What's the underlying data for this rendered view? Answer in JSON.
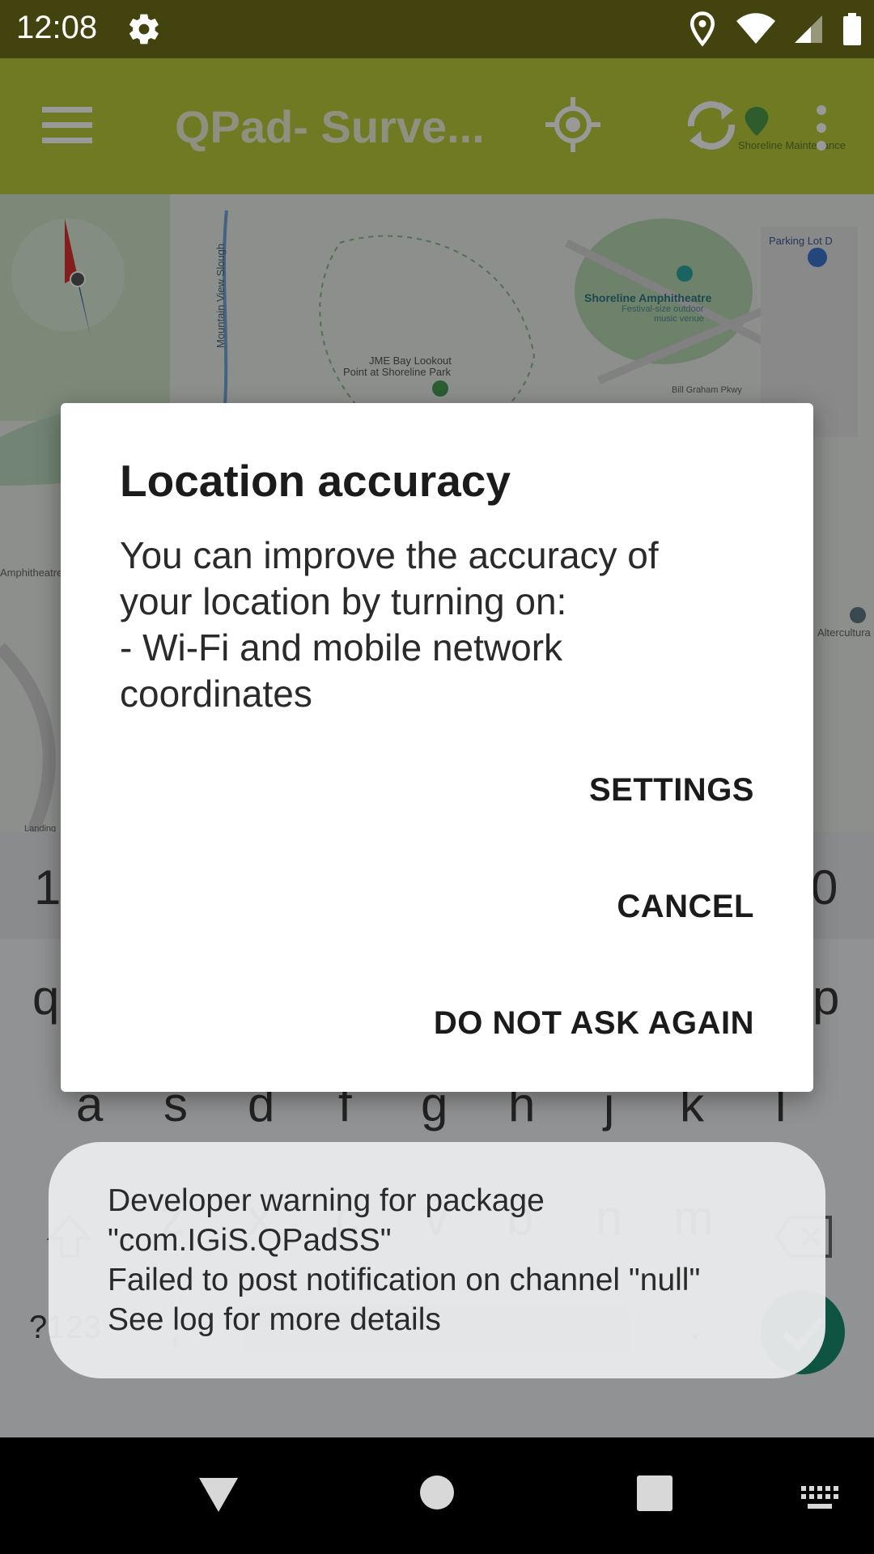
{
  "status_bar": {
    "time": "12:08"
  },
  "app": {
    "title": "QPad- Surve...",
    "map": {
      "labels": [
        "Mountain View Slough",
        "Shoreline Amphitheatre",
        "Festival-size outdoor",
        "music venue",
        "JME Bay Lookout",
        "Point at Shoreline Park",
        "Parking Lot D",
        "Bill Graham Pkwy",
        "Shoreline Maintenance",
        "Amphitheatre",
        "Altercultura",
        "Landing"
      ]
    },
    "keyboard": {
      "number_row": [
        "1",
        "0"
      ],
      "row1": [
        "q",
        "p"
      ],
      "row2": [
        "a",
        "s",
        "d",
        "f",
        "g",
        "h",
        "j",
        "k",
        "l"
      ],
      "row3": [
        "z",
        "x",
        "c",
        "v",
        "b",
        "n",
        "m"
      ],
      "symbols_key": "?123",
      "comma": ",",
      "period": "."
    }
  },
  "dialog": {
    "title": "Location accuracy",
    "message": "You can improve the accuracy of\nyour location by turning on:\n- Wi-Fi and mobile network\ncoordinates",
    "buttons": {
      "settings": "SETTINGS",
      "cancel": "CANCEL",
      "do_not_ask": "DO NOT ASK AGAIN"
    }
  },
  "toast": {
    "text": "Developer warning for package\n\"com.IGiS.QPadSS\"\nFailed to post notification on channel \"null\"\nSee log for more details"
  },
  "colors": {
    "status_bar": "#43430f",
    "toolbar": "#b9cc3a",
    "dialog_bg": "#ffffff",
    "toast_bg": "#e8e9ea",
    "done_button": "#1a8a70"
  }
}
